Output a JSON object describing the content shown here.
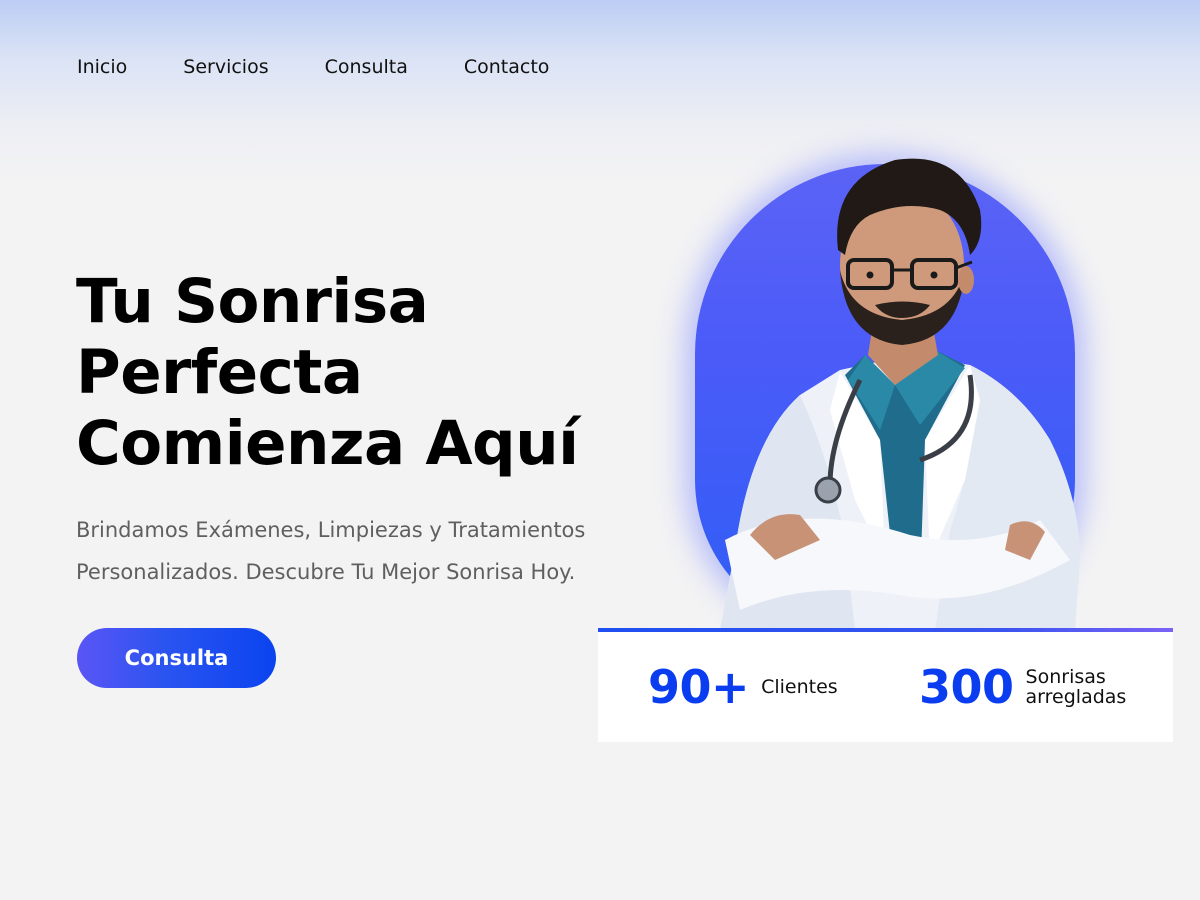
{
  "nav": {
    "items": [
      "Inicio",
      "Servicios",
      "Consulta",
      "Contacto"
    ]
  },
  "hero": {
    "title_lines": [
      "Tu Sonrisa",
      "Perfecta",
      "Comienza Aquí"
    ],
    "subtitle_lines": [
      "Brindamos Exámenes, Limpiezas y Tratamientos",
      "Personalizados. Descubre Tu Mejor Sonrisa Hoy."
    ],
    "cta_label": "Consulta"
  },
  "stats": [
    {
      "number": "90+",
      "label_lines": [
        "Clientes"
      ]
    },
    {
      "number": "300",
      "label_lines": [
        "Sonrisas",
        "arregladas"
      ]
    }
  ],
  "image": {
    "subject": "doctor-portrait"
  },
  "colors": {
    "accent": "#0b3df0",
    "button_gradient_start": "#5a55f5",
    "button_gradient_end": "#0a44ef",
    "photo_bg": "#4b5bf8",
    "page_bg": "#f3f3f4",
    "header_tint": "#bccdf4"
  }
}
